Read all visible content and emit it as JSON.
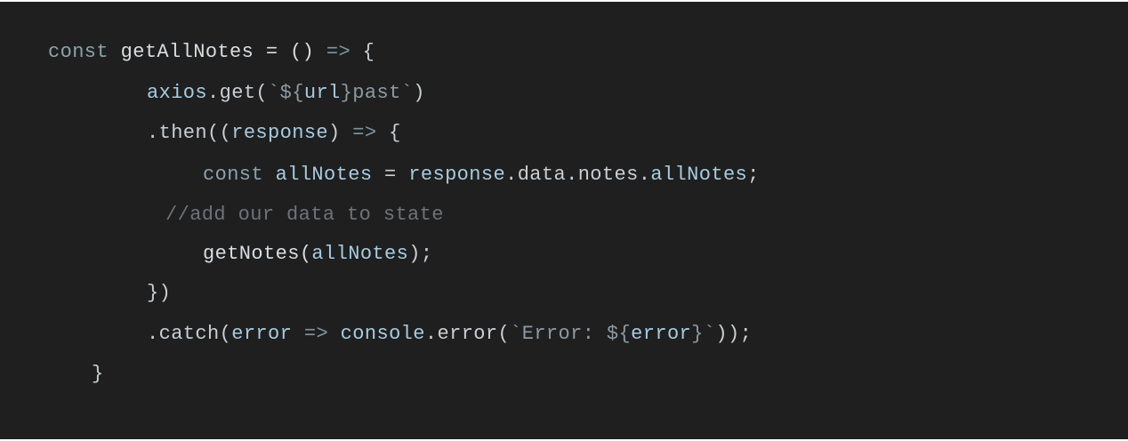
{
  "colors": {
    "background": "#1f1f1f",
    "keyword": "#8aa2ae",
    "function": "#d9dee2",
    "punctuation": "#c9cfd4",
    "identifier": "#a8cbe0",
    "string": "#8c9aa3",
    "arrow": "#7e95a2",
    "comment": "#6d7378"
  },
  "code": {
    "lines": [
      [
        {
          "t": "const",
          "c": "kw"
        },
        {
          "t": " getAllNotes = () ",
          "c": "fn"
        },
        {
          "t": "=>",
          "c": "arrow"
        },
        {
          "t": " {",
          "c": "plain"
        }
      ],
      [
        {
          "t": "axios",
          "c": "id"
        },
        {
          "t": ".get(",
          "c": "plain"
        },
        {
          "t": "`${",
          "c": "str"
        },
        {
          "t": "url",
          "c": "id"
        },
        {
          "t": "}past`",
          "c": "str"
        },
        {
          "t": ")",
          "c": "plain"
        }
      ],
      [
        {
          "t": ".then((",
          "c": "plain"
        },
        {
          "t": "response",
          "c": "id"
        },
        {
          "t": ") ",
          "c": "plain"
        },
        {
          "t": "=>",
          "c": "arrow"
        },
        {
          "t": " {",
          "c": "plain"
        }
      ],
      [
        {
          "t": "const",
          "c": "kw"
        },
        {
          "t": " ",
          "c": "plain"
        },
        {
          "t": "allNotes",
          "c": "id"
        },
        {
          "t": " = ",
          "c": "plain"
        },
        {
          "t": "response",
          "c": "id"
        },
        {
          "t": ".data.notes.",
          "c": "plain"
        },
        {
          "t": "allNotes",
          "c": "id"
        },
        {
          "t": ";",
          "c": "plain"
        }
      ],
      [
        {
          "t": "//add our data to state",
          "c": "cmt"
        }
      ],
      [
        {
          "t": "getNotes(",
          "c": "fn"
        },
        {
          "t": "allNotes",
          "c": "id"
        },
        {
          "t": ");",
          "c": "plain"
        }
      ],
      [
        {
          "t": "})",
          "c": "plain"
        }
      ],
      [
        {
          "t": ".catch(",
          "c": "plain"
        },
        {
          "t": "error",
          "c": "id"
        },
        {
          "t": " ",
          "c": "plain"
        },
        {
          "t": "=>",
          "c": "arrow"
        },
        {
          "t": " ",
          "c": "plain"
        },
        {
          "t": "console",
          "c": "id"
        },
        {
          "t": ".error(",
          "c": "plain"
        },
        {
          "t": "`Error: ${",
          "c": "str"
        },
        {
          "t": "error",
          "c": "id"
        },
        {
          "t": "}`",
          "c": "str"
        },
        {
          "t": "));",
          "c": "plain"
        }
      ],
      [
        {
          "t": "}",
          "c": "plain"
        }
      ]
    ]
  }
}
